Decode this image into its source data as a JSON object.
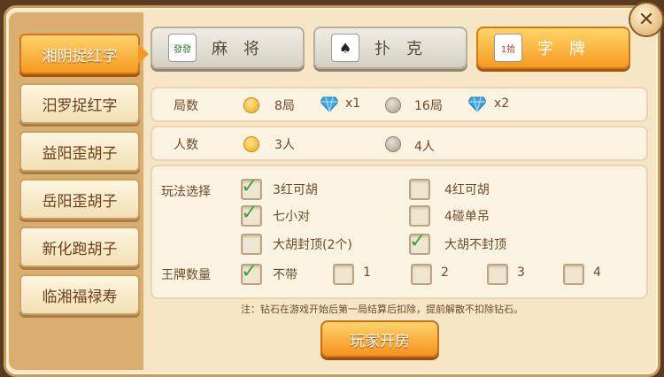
{
  "sidebar": {
    "items": [
      {
        "label": "湘阴捉红字",
        "active": true
      },
      {
        "label": "汨罗捉红字",
        "active": false
      },
      {
        "label": "益阳歪胡子",
        "active": false
      },
      {
        "label": "岳阳歪胡子",
        "active": false
      },
      {
        "label": "新化跑胡子",
        "active": false
      },
      {
        "label": "临湘福禄寿",
        "active": false
      }
    ]
  },
  "tabs": [
    {
      "label": "麻将",
      "icon": "mahjong-tile-icon",
      "icon_text": "發發",
      "active": false
    },
    {
      "label": "扑克",
      "icon": "playing-cards-icon",
      "active": false
    },
    {
      "label": "字牌",
      "icon": "word-card-icon",
      "icon_text": "1拾",
      "active": true
    }
  ],
  "rounds": {
    "label": "局数",
    "options": [
      {
        "label": "8局",
        "cost": "x1",
        "selected": true
      },
      {
        "label": "16局",
        "cost": "x2",
        "selected": false
      }
    ]
  },
  "players": {
    "label": "人数",
    "options": [
      {
        "label": "3人",
        "selected": true
      },
      {
        "label": "4人",
        "selected": false
      }
    ]
  },
  "rules": {
    "label": "玩法选择",
    "options": [
      {
        "label": "3红可胡",
        "checked": true
      },
      {
        "label": "4红可胡",
        "checked": false
      },
      {
        "label": "七小对",
        "checked": true
      },
      {
        "label": "4碰单吊",
        "checked": false
      },
      {
        "label": "大胡封顶(2个)",
        "checked": false
      },
      {
        "label": "大胡不封顶",
        "checked": true
      }
    ]
  },
  "king_count": {
    "label": "王牌数量",
    "options": [
      {
        "label": "不带",
        "checked": true
      },
      {
        "label": "1",
        "checked": false
      },
      {
        "label": "2",
        "checked": false
      },
      {
        "label": "3",
        "checked": false
      },
      {
        "label": "4",
        "checked": false
      }
    ]
  },
  "note": "注：钻石在游戏开始后第一局结算后扣除，提前解散不扣除钻石。",
  "create_button": "玩家开房",
  "close_icon": "close-icon",
  "colors": {
    "accent": "#f59a20",
    "check": "#43a33a",
    "gem": "#3aa8e8"
  }
}
